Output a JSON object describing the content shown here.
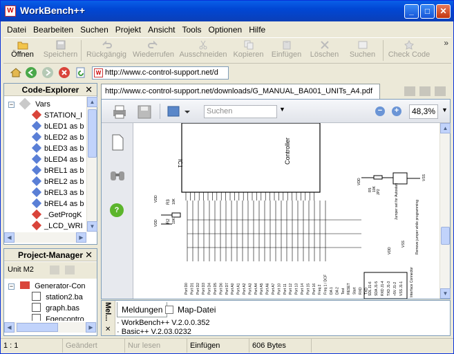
{
  "window": {
    "title": "WorkBench++",
    "app_icon": "W",
    "minimize_glyph": "_",
    "maximize_glyph": "□",
    "close_glyph": "✕"
  },
  "menu": [
    "Datei",
    "Bearbeiten",
    "Suchen",
    "Projekt",
    "Ansicht",
    "Tools",
    "Optionen",
    "Hilfe"
  ],
  "toolbar": {
    "items": [
      {
        "label": "Öffnen",
        "icon": "open-folder-icon",
        "enabled": true
      },
      {
        "label": "Speichern",
        "icon": "save-icon",
        "enabled": false
      },
      {
        "label": "Rückgängig",
        "icon": "undo-icon",
        "enabled": false
      },
      {
        "label": "Wiederrufen",
        "icon": "redo-icon",
        "enabled": false
      },
      {
        "label": "Ausschneiden",
        "icon": "cut-icon",
        "enabled": false
      },
      {
        "label": "Kopieren",
        "icon": "copy-icon",
        "enabled": false
      },
      {
        "label": "Einfügen",
        "icon": "paste-icon",
        "enabled": false
      },
      {
        "label": "Löschen",
        "icon": "delete-icon",
        "enabled": false
      },
      {
        "label": "Suchen",
        "icon": "search-icon",
        "enabled": false
      },
      {
        "label": "Check Code",
        "icon": "check-code-icon",
        "enabled": false
      }
    ],
    "overflow_glyph": "»"
  },
  "address": {
    "url": "http://www.c-control-support.net/d",
    "logo": "W"
  },
  "code_explorer": {
    "title": "Code-Explorer",
    "close": "✕",
    "root": "Vars",
    "items": [
      {
        "label": "STATION_I",
        "kind": "const"
      },
      {
        "label": "bLED1 as b",
        "kind": "var"
      },
      {
        "label": "bLED2 as b",
        "kind": "var"
      },
      {
        "label": "bLED3 as b",
        "kind": "var"
      },
      {
        "label": "bLED4 as b",
        "kind": "var"
      },
      {
        "label": "bREL1 as b",
        "kind": "var"
      },
      {
        "label": "bREL2 as b",
        "kind": "var"
      },
      {
        "label": "bREL3 as b",
        "kind": "var"
      },
      {
        "label": "bREL4 as b",
        "kind": "var"
      },
      {
        "label": "_GetProgK",
        "kind": "func"
      },
      {
        "label": "_LCD_WRI",
        "kind": "func"
      }
    ]
  },
  "project_manager": {
    "title": "Project-Manager",
    "close": "✕",
    "unit": "Unit M2",
    "root": "Generator-Con",
    "files": [
      "station2.ba",
      "graph.bas",
      "Fgencontro"
    ]
  },
  "document": {
    "tab_title": "http://www.c-control-support.net/downloads/G_MANUAL_BA001_UNITs_A4.pdf",
    "search_placeholder": "Suchen",
    "zoom": "48,3%",
    "schematic": {
      "ic_label": "IC1",
      "controller_label": "Controller",
      "r3": "R3",
      "r3_val": "10K",
      "r2": "R2",
      "r2_val": "10K",
      "vdd": "VDD",
      "vss": "VSS",
      "port_labels": [
        "Port D0",
        "Port D1",
        "Port D2",
        "Port D3",
        "Port D4",
        "Port D5",
        "Port D6",
        "Port D7",
        "Port A0",
        "Port A1",
        "Port A2",
        "Port A3",
        "Port A4",
        "Port A5",
        "Port A6",
        "Port A7",
        "Port 10",
        "Port 11",
        "Port 12",
        "Port 13",
        "Port 14",
        "Port 15",
        "Port 16"
      ],
      "misc_labels": [
        "Freq 2",
        "Freq 1 / DCF",
        "DA 1",
        "DA 2",
        "Test",
        "RESET",
        "Start",
        "RXD",
        "TXD"
      ],
      "connector_pins": [
        "SDL J1-6",
        "SDA J1-5",
        "RXD J1-4",
        "TXD J1-3",
        "+5V J1-2",
        "VSS J1-1"
      ],
      "connector_title": "Interface Connector",
      "jumper": "JP2",
      "jumper_text": "Jumper set for Autostart",
      "jumper_text2": "Remove jumper while programming",
      "r5": "R5",
      "r5_val": "10K"
    }
  },
  "messages": {
    "side_label": "Mel...",
    "tabs": [
      "Meldungen",
      "Map-Datei"
    ],
    "lines": [
      "WorkBench++ V.2.0.0.352",
      "Basic++ V.2.03.0232"
    ]
  },
  "status": {
    "position": "1 : 1",
    "modified": "Geändert",
    "readonly": "Nur lesen",
    "mode": "Einfügen",
    "size": "606 Bytes"
  },
  "colors": {
    "titlebar": "#0147d4",
    "accent_blue": "#316ac5",
    "gem_blue": "#5a7fd6",
    "gem_red": "#d9443a",
    "help_green": "#5cb52c"
  }
}
